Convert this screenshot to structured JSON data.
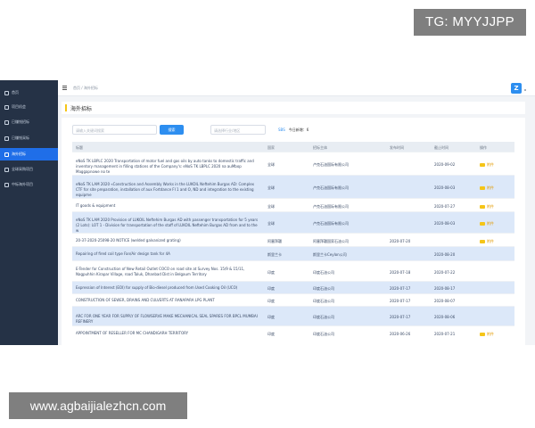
{
  "watermarks": {
    "top": "TG: MYYJJPP",
    "bottom": "www.agbaijialezhcn.com"
  },
  "sidebar": {
    "items": [
      {
        "label": "首页",
        "active": false
      },
      {
        "label": "项目机会",
        "active": false
      },
      {
        "label": "已赚钱招标",
        "active": false
      },
      {
        "label": "已赚钱采标",
        "active": false
      },
      {
        "label": "海外招标",
        "active": true
      },
      {
        "label": "全球采购项目",
        "active": false
      },
      {
        "label": "中标海外项目",
        "active": false
      }
    ]
  },
  "topbar": {
    "breadcrumb": "首页 / 海外招标",
    "logo": "Z"
  },
  "page": {
    "title": "海外招标"
  },
  "toolbar": {
    "search_placeholder": "请输入关键词搜索",
    "search_button": "搜索",
    "select_placeholder": "请选择行业/地区",
    "today_link": "SBS",
    "today_label": "今日新增：6"
  },
  "table": {
    "columns": [
      "标题",
      "国家",
      "招标主体",
      "发布时间",
      "截止时间",
      "操作"
    ],
    "rows": [
      {
        "title": "eNoS TK LBPLC 2020 Transportation of motor fuel and gas oils by auto tanks to domestic traffic and inventory management in filling stations of the Company's: eNoS TK LBPLC 2020 na auMbop Maggapnowe no te",
        "country": "全球",
        "org": "卢克石油国际有限公司",
        "pub": "",
        "deadline": "2020-09-02",
        "action": "附件",
        "blue": false
      },
      {
        "title": "eNoS TK LAM 2020 «Construction and Assembly Works in the LUKOIL Neftehim Burgas AD: Complex CTF for site preparation, installation of aux Fortdance FI 1 and O, ND and integration to the existing equipme",
        "country": "全球",
        "org": "卢克石油国际有限公司",
        "pub": "",
        "deadline": "2020-08-03",
        "action": "附件",
        "blue": true
      },
      {
        "title": "IT goods & equipment",
        "country": "全球",
        "org": "卢克石油国际有限公司",
        "pub": "",
        "deadline": "2020-07-27",
        "action": "附件",
        "blue": false
      },
      {
        "title": "eNoS TK LAM 2020 Provision of LUKOIL Neftehim Burgas AD with passenger transportation for 5 years (2 Lots): LOT 1 - Division for transportation of the staff of LUKOIL Neftehim Burgas AD from and to the w",
        "country": "全球",
        "org": "卢克石油国际有限公司",
        "pub": "",
        "deadline": "2020-08-03",
        "action": "附件",
        "blue": true
      },
      {
        "title": "20-37-2020-25098-20 NOTICE (welded galvanized grating)",
        "country": "阿塞拜疆",
        "org": "阿塞拜疆国家石油公司",
        "pub": "2020-07-20",
        "deadline": "",
        "action": "附件",
        "blue": false
      },
      {
        "title": "Repairing of fired coil type Fan/Air design tank for 4A",
        "country": "斯里兰卡",
        "org": "斯里兰卡Ceylon公司",
        "pub": "",
        "deadline": "2020-08-20",
        "action": "",
        "blue": true
      },
      {
        "title": "E-Tender for Construction of New Retail Outlet COCO on road site at Survey Nos. 15/9 & 15/11, Nagpuhhin Kirapar Village, road Taluk, Dhanbad Dist in Belgaum Territory",
        "country": "印度",
        "org": "印度石油公司",
        "pub": "2020-07-18",
        "deadline": "2020-07-22",
        "action": "",
        "blue": false
      },
      {
        "title": "Expression of Interest (EOI) for supply of Bio-diesel produced from Used Cooking Oil (UCO)",
        "country": "印度",
        "org": "印度石油公司",
        "pub": "2020-07-17",
        "deadline": "2020-08-17",
        "action": "",
        "blue": true
      },
      {
        "title": "CONSTRUCTION OF SEWER, DRAINS AND CULVERTS AT RANAPARA LPG PLANT",
        "country": "印度",
        "org": "印度石油公司",
        "pub": "2020-07-17",
        "deadline": "2020-08-07",
        "action": "",
        "blue": false
      },
      {
        "title": "ARC FOR ONE YEAR FOR SUPPLY OF FLOWSERVE MAKE MECHANICAL SEAL SPARES FOR BPCL MUMBAI REFINERY",
        "country": "印度",
        "org": "印度石油公司",
        "pub": "2020-07-17",
        "deadline": "2020-08-06",
        "action": "",
        "blue": true
      },
      {
        "title": "APPOINTMENT OF RESELLER FOR MC CHANDIGARH TERRITORY",
        "country": "印度",
        "org": "印度石油公司",
        "pub": "2020-06-26",
        "deadline": "2020-07-21",
        "action": "附件",
        "blue": false
      }
    ]
  }
}
